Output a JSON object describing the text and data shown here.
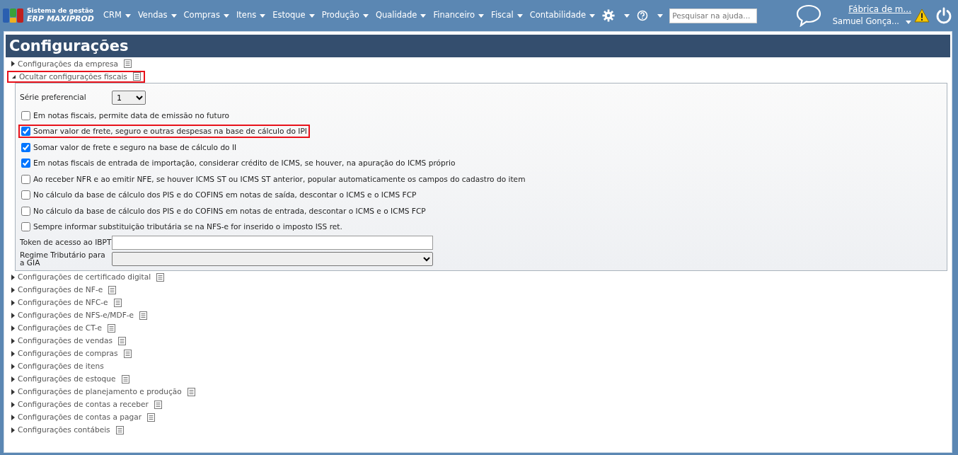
{
  "header": {
    "logo_line1": "Sistema de gestão",
    "logo_line2": "ERP MAXIPROD",
    "menus": [
      "CRM",
      "Vendas",
      "Compras",
      "Itens",
      "Estoque",
      "Produção",
      "Qualidade",
      "Financeiro",
      "Fiscal",
      "Contabilidade"
    ],
    "search": {
      "placeholder": "Pesquisar na ajuda..."
    },
    "company": "Fábrica de m...",
    "user": "Samuel Gonça..."
  },
  "page_title": "Configurações",
  "sections": [
    {
      "label": "Configurações da empresa",
      "expanded": false,
      "doc_icon": true,
      "highlighted": false
    },
    {
      "label": "Ocultar configurações fiscais",
      "expanded": true,
      "doc_icon": true,
      "highlighted": true,
      "fields": [
        {
          "kind": "select",
          "label": "Série preferencial",
          "value": "1"
        },
        {
          "kind": "checkbox",
          "label": "Em notas fiscais, permite data de emissão no futuro",
          "checked": false,
          "highlighted": false
        },
        {
          "kind": "checkbox",
          "label": "Somar valor de frete, seguro e outras despesas na base de cálculo do IPI",
          "checked": true,
          "highlighted": true
        },
        {
          "kind": "checkbox",
          "label": "Somar valor de frete e seguro na base de cálculo do II",
          "checked": true,
          "highlighted": false
        },
        {
          "kind": "checkbox",
          "label": "Em notas fiscais de entrada de importação, considerar crédito de ICMS, se houver, na apuração do ICMS próprio",
          "checked": true,
          "highlighted": false
        },
        {
          "kind": "checkbox",
          "label": "Ao receber NFR e ao emitir NFE, se houver ICMS ST ou ICMS ST anterior, popular automaticamente os campos do cadastro do item",
          "checked": false,
          "highlighted": false
        },
        {
          "kind": "checkbox",
          "label": "No cálculo da base de cálculo dos PIS e do COFINS em notas de saída, descontar o ICMS e o ICMS FCP",
          "checked": false,
          "highlighted": false
        },
        {
          "kind": "checkbox",
          "label": "No cálculo da base de cálculo dos PIS e do COFINS em notas de entrada, descontar o ICMS e o ICMS FCP",
          "checked": false,
          "highlighted": false
        },
        {
          "kind": "checkbox",
          "label": "Sempre informar substituição tributária se na NFS-e for inserido o imposto ISS ret.",
          "checked": false,
          "highlighted": false
        },
        {
          "kind": "text",
          "label": "Token de acesso ao IBPT"
        },
        {
          "kind": "wideselect",
          "label": "Regime Tributário para a GIA"
        }
      ]
    },
    {
      "label": "Configurações de certificado digital",
      "expanded": false,
      "doc_icon": true,
      "highlighted": false
    },
    {
      "label": "Configurações de NF-e",
      "expanded": false,
      "doc_icon": true,
      "highlighted": false
    },
    {
      "label": "Configurações de NFC-e",
      "expanded": false,
      "doc_icon": true,
      "highlighted": false
    },
    {
      "label": "Configurações de NFS-e/MDF-e",
      "expanded": false,
      "doc_icon": true,
      "highlighted": false
    },
    {
      "label": "Configurações de CT-e",
      "expanded": false,
      "doc_icon": true,
      "highlighted": false
    },
    {
      "label": "Configurações de vendas",
      "expanded": false,
      "doc_icon": true,
      "highlighted": false
    },
    {
      "label": "Configurações de compras",
      "expanded": false,
      "doc_icon": true,
      "highlighted": false
    },
    {
      "label": "Configurações de itens",
      "expanded": false,
      "doc_icon": false,
      "highlighted": false
    },
    {
      "label": "Configurações de estoque",
      "expanded": false,
      "doc_icon": true,
      "highlighted": false
    },
    {
      "label": "Configurações de planejamento e produção",
      "expanded": false,
      "doc_icon": true,
      "highlighted": false
    },
    {
      "label": "Configurações de contas a receber",
      "expanded": false,
      "doc_icon": true,
      "highlighted": false
    },
    {
      "label": "Configurações de contas a pagar",
      "expanded": false,
      "doc_icon": true,
      "highlighted": false
    },
    {
      "label": "Configurações contábeis",
      "expanded": false,
      "doc_icon": true,
      "highlighted": false
    }
  ]
}
